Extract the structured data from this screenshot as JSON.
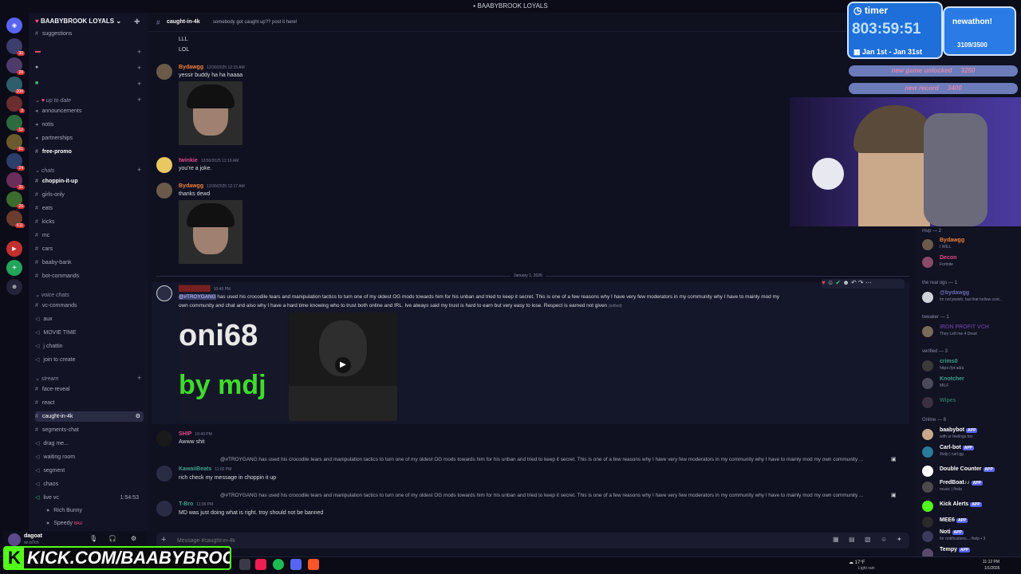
{
  "window_title": "BAABYBROOK LOYALS",
  "guild_name": "BAABYBROOK LOYALS",
  "server_badges": [
    "30",
    "28",
    "208",
    "3",
    "12",
    "61",
    "24",
    "31",
    "26",
    "611"
  ],
  "top_channel": "suggestions",
  "categories": {
    "up_to_date": "up to date",
    "chats": "chats",
    "voice_chats": "voice chats",
    "stream": "stream"
  },
  "channels": {
    "announcements": "announcements",
    "notis": "notis",
    "partnerships": "partnerships",
    "free_promo": "free-promo",
    "choppin": "choppin-it-up",
    "girls_only": "girls-only",
    "eats": "eats",
    "kicks": "kicks",
    "mc": "mc",
    "cars": "cars",
    "baaby_bank": "baaby-bank",
    "bot_commands": "bot-commands",
    "vc_commands": "vc-commands",
    "aux": "aux",
    "movie_time": "MOVIE TIME",
    "j_chattin": "j chattin",
    "join_to_create": "join to create",
    "face_reveal": "face-reveal",
    "react": "react",
    "caught_in_4k": "caught-in-4k",
    "segments_chat": "segments-chat",
    "drag_me": "drag me...",
    "waiting_room": "waiting room",
    "segment": "segment",
    "chaos": "chaos",
    "live_vc": "live vc"
  },
  "voice": {
    "live_time": "1:54:53",
    "user1": "Rich Bunny",
    "user2": "Speedy",
    "user2_tag": "BAU"
  },
  "current_user": {
    "name": "dagoat",
    "status": "on biTch"
  },
  "header": {
    "channel": "caught-in-4k",
    "topic": "somebody got caught up?? post it here!"
  },
  "messages": {
    "lll": "LLL",
    "lol": "LOL",
    "m1_name": "Bydawgg",
    "m1_time": "12/30/2025 12:15 AM",
    "m1_text": "yessir buddy ha ha haaaa",
    "m2_name": "twinkie",
    "m2_time": "12/30/2025 12:16 AM",
    "m2_text": "you're a joke.",
    "m3_name": "Bydawgg",
    "m3_time": "12/30/2025 12:17 AM",
    "m3_text": "thanks dewd",
    "divider": "January 1, 2026",
    "m4_time": "10:49 PM",
    "m4_mention": "@#TROYGANG",
    "m4_line1": " has used his crocodile tears and manipulation tactics to turn one of my oldest OG mods towards him for his unban and tried to keep it secret. This is one of a few reasons why I have very few moderators in my community why I have to mainly mod my",
    "m4_line2": "own community and chat and also why I have a hard time knowing who to trust both online and IRL. Ive always said my trust is hard to earn but very easy to lose. Respect is earned not given",
    "m4_edited": "(edited)",
    "embed_big": "oni68",
    "embed_sub": "by mdj",
    "m5_name": "SHIP",
    "m5_time": "10:49 PM",
    "m5_text": "Awww shit",
    "reply_text": "@#TROYGANG has used his crocodile tears and manipulation tactics to turn one of my oldest OG mods towards him for his unban and tried to keep it secret. This is one of a few reasons why I have very few moderators in my community why I have to mainly mod my own community ...",
    "m6_name": "KawaiiBeats",
    "m6_time": "11:02 PM",
    "m6_text": "rich check my message in choppin it up",
    "m7_name": "T-Bro",
    "m7_time": "11:06 PM",
    "m7_text": "MD was just doing what is right. troy should not be banned"
  },
  "composer_placeholder": "Message #caught-in-4k",
  "overlay": {
    "timer_label": "timer",
    "timer_value": "803:59:51",
    "date_range": "Jan 1st - Jan 31st",
    "subathon_label": "newathon!",
    "subathon_count": "3109/3500",
    "goal1": "new game unlocked",
    "goal1_val": "3250",
    "goal2": "new record",
    "goal2_val": "3400"
  },
  "members": {
    "mvp_label": "mvp — 2",
    "mvp1": "Bydawgg",
    "mvp1_status": "I WILL",
    "mvp2": "Decon",
    "mvp2_status": "Fortnite",
    "real_og_label": "the real ogs — 1",
    "og1": "@bydawgg",
    "og1_status": "Im not jewish, but that hollow cost...",
    "tweaker_label": "tweaker — 1",
    "tw1": "IRON PROFIT VCH",
    "tw1_status": "They Left me 4 Dead",
    "verified_label": "verified — 3",
    "v1": "crims0",
    "v1_status": "https://pt.ad/a",
    "v2": "Knotcher",
    "v2_status": "MILF",
    "v3": "Wipes",
    "online_label": "Online — 8",
    "o1": "baabybot",
    "o1_status": "with ur feelings too",
    "o2": "Carl-bot",
    "o2_status": "/help | carl.gg",
    "o3": "Double Counter",
    "o4": "FredBoat♪♪",
    "o4_status": "music | /help",
    "o5": "Kick Alerts",
    "o6": "MEE6",
    "o7": "Noti",
    "o7_status": "for notifications... /help • 3",
    "o8": "Tempy",
    "app_tag": "APP"
  },
  "kick_banner": "KICK.COM/BAABYBROOK",
  "taskbar": {
    "weather_temp": "17°F",
    "weather_desc": "Light rain",
    "time": "11:12 PM",
    "date": "1/1/2026"
  }
}
